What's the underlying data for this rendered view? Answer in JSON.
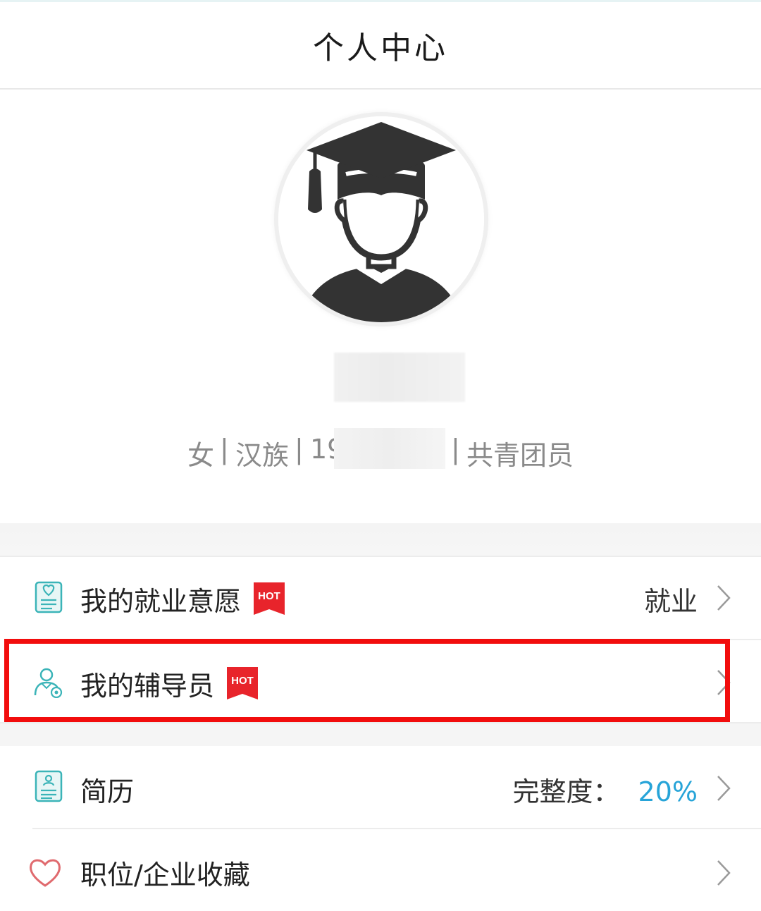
{
  "header": {
    "title": "个人中心"
  },
  "profile": {
    "info": {
      "gender": "女",
      "sep1": "|",
      "ethnicity": "汉族",
      "sep2": "|",
      "birth_partial": "19",
      "sep3": "|",
      "political_status": "共青团员"
    }
  },
  "menu": {
    "items": [
      {
        "label": "我的就业意愿",
        "badge": "HOT",
        "value": "就业",
        "icon": "intention-document-icon"
      },
      {
        "label": "我的辅导员",
        "badge": "HOT",
        "value": "",
        "icon": "counselor-person-icon"
      },
      {
        "label": "简历",
        "value_label": "完整度：",
        "value_pct": "20%",
        "icon": "resume-document-icon"
      },
      {
        "label": "职位/企业收藏",
        "icon": "heart-icon"
      }
    ]
  },
  "colors": {
    "accent": "#27a4d8",
    "hot_badge": "#e8242b",
    "highlight_border": "#f20d0d",
    "icon_teal": "#3bb4b8"
  }
}
